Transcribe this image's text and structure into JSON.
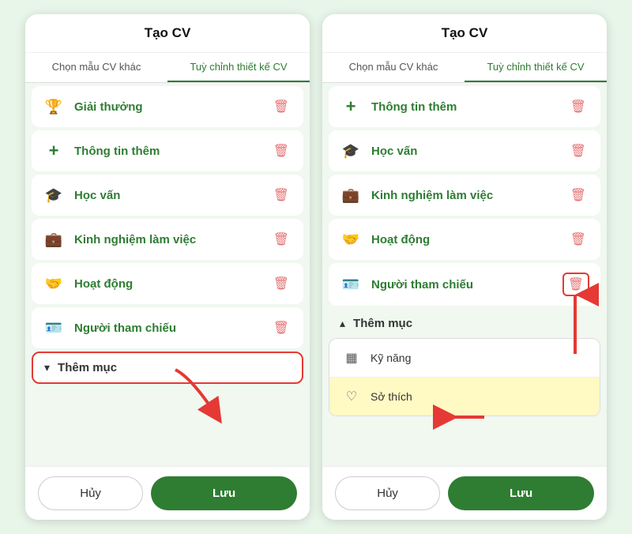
{
  "panels": [
    {
      "id": "left",
      "title": "Tạo CV",
      "tabs": [
        {
          "label": "Chọn mẫu CV khác",
          "active": false
        },
        {
          "label": "Tuỳ chỉnh thiết kế CV",
          "active": true
        }
      ],
      "menuItems": [
        {
          "icon": "trophy",
          "label": "Giải thưởng",
          "highlighted": false
        },
        {
          "icon": "plus",
          "label": "Thông tin thêm",
          "highlighted": false
        },
        {
          "icon": "graduation",
          "label": "Học vấn",
          "highlighted": false
        },
        {
          "icon": "briefcase",
          "label": "Kinh nghiệm làm việc",
          "highlighted": false
        },
        {
          "icon": "heart",
          "label": "Hoạt động",
          "highlighted": false
        },
        {
          "icon": "card",
          "label": "Người tham chiếu",
          "highlighted": false
        }
      ],
      "themMuc": {
        "label": "Thêm mục",
        "chevron": "▾",
        "expanded": false,
        "highlighted": true
      },
      "footer": {
        "huy": "Hủy",
        "luu": "Lưu"
      }
    },
    {
      "id": "right",
      "title": "Tạo CV",
      "tabs": [
        {
          "label": "Chọn mẫu CV khác",
          "active": false
        },
        {
          "label": "Tuỳ chỉnh thiết kế CV",
          "active": true
        }
      ],
      "menuItems": [
        {
          "icon": "plus",
          "label": "Thông tin thêm",
          "highlighted": false
        },
        {
          "icon": "graduation",
          "label": "Học vấn",
          "highlighted": false
        },
        {
          "icon": "briefcase",
          "label": "Kinh nghiệm làm việc",
          "highlighted": false
        },
        {
          "icon": "heart",
          "label": "Hoạt động",
          "highlighted": false
        },
        {
          "icon": "card",
          "label": "Người tham chiếu",
          "highlighted": true,
          "deleteHighlighted": true
        }
      ],
      "themMuc": {
        "label": "Thêm mục",
        "chevron": "▴",
        "expanded": true,
        "highlighted": false,
        "items": [
          {
            "icon": "skills",
            "label": "Kỹ năng"
          },
          {
            "icon": "hobby",
            "label": "Sở thích",
            "highlighted": true
          }
        ]
      },
      "footer": {
        "huy": "Hủy",
        "luu": "Lưu"
      }
    }
  ],
  "icons": {
    "trophy": "🏆",
    "plus": "+",
    "graduation": "🎓",
    "briefcase": "💼",
    "heart": "🤝",
    "card": "🪪",
    "skills": "▦",
    "hobby": "♡",
    "delete": "🗑"
  }
}
